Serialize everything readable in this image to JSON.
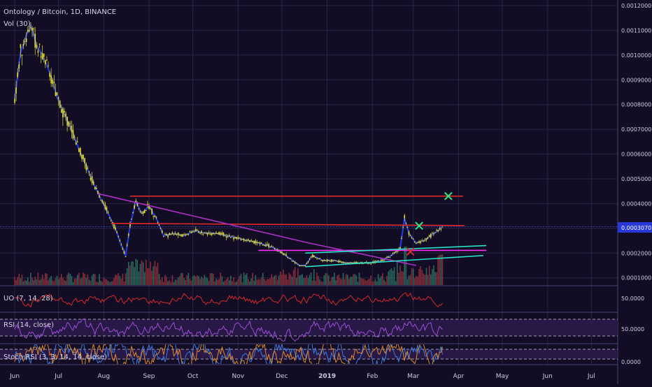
{
  "chart_data": {
    "type": "candlestick",
    "title": "Ontology / Bitcoin, 1D, BINANCE",
    "volume_label": "Vol (30)",
    "x_ticks": [
      "Jun",
      "Jul",
      "Aug",
      "Sep",
      "Oct",
      "Nov",
      "Dec",
      "2019",
      "Feb",
      "Mar",
      "Apr",
      "May",
      "Jun",
      "Jul"
    ],
    "price_axis": {
      "ticks": [
        "0.0001000",
        "0.0002000",
        "0.0003000",
        "0.0004000",
        "0.0005000",
        "0.0006000",
        "0.0007000",
        "0.0008000",
        "0.0009000",
        "0.0010000",
        "0.0011000",
        "0.0012000"
      ],
      "current_price_label": "0.0003070",
      "current_price": 0.000307,
      "ylim": [
        9.35e-05,
        0.0012
      ]
    },
    "price_series": [
      {
        "date": "2018-06-01",
        "price": 0.00082
      },
      {
        "date": "2018-06-05",
        "price": 0.00101
      },
      {
        "date": "2018-06-09",
        "price": 0.00108
      },
      {
        "date": "2018-06-12",
        "price": 0.00112
      },
      {
        "date": "2018-06-16",
        "price": 0.00104
      },
      {
        "date": "2018-06-20",
        "price": 0.001
      },
      {
        "date": "2018-06-25",
        "price": 0.00093
      },
      {
        "date": "2018-06-30",
        "price": 0.00083
      },
      {
        "date": "2018-07-05",
        "price": 0.00076
      },
      {
        "date": "2018-07-10",
        "price": 0.0007
      },
      {
        "date": "2018-07-15",
        "price": 0.00062
      },
      {
        "date": "2018-07-20",
        "price": 0.00055
      },
      {
        "date": "2018-07-25",
        "price": 0.00048
      },
      {
        "date": "2018-07-30",
        "price": 0.00042
      },
      {
        "date": "2018-08-04",
        "price": 0.00036
      },
      {
        "date": "2018-08-09",
        "price": 0.0003
      },
      {
        "date": "2018-08-13",
        "price": 0.00023
      },
      {
        "date": "2018-08-16",
        "price": 0.00019
      },
      {
        "date": "2018-08-19",
        "price": 0.00031
      },
      {
        "date": "2018-08-23",
        "price": 0.00041
      },
      {
        "date": "2018-08-27",
        "price": 0.00036
      },
      {
        "date": "2018-09-01",
        "price": 0.00039
      },
      {
        "date": "2018-09-06",
        "price": 0.00034
      },
      {
        "date": "2018-09-11",
        "price": 0.00027
      },
      {
        "date": "2018-09-18",
        "price": 0.00028
      },
      {
        "date": "2018-09-25",
        "price": 0.00027
      },
      {
        "date": "2018-10-02",
        "price": 0.00029
      },
      {
        "date": "2018-10-10",
        "price": 0.00028
      },
      {
        "date": "2018-10-17",
        "price": 0.00028
      },
      {
        "date": "2018-10-24",
        "price": 0.00027
      },
      {
        "date": "2018-11-01",
        "price": 0.00026
      },
      {
        "date": "2018-11-08",
        "price": 0.00025
      },
      {
        "date": "2018-11-15",
        "price": 0.00024
      },
      {
        "date": "2018-11-22",
        "price": 0.00023
      },
      {
        "date": "2018-11-29",
        "price": 0.00021
      },
      {
        "date": "2018-12-06",
        "price": 0.00018
      },
      {
        "date": "2018-12-13",
        "price": 0.00015
      },
      {
        "date": "2018-12-17",
        "price": 0.00015
      },
      {
        "date": "2018-12-22",
        "price": 0.00019
      },
      {
        "date": "2018-12-29",
        "price": 0.00017
      },
      {
        "date": "2019-01-06",
        "price": 0.00017
      },
      {
        "date": "2019-01-14",
        "price": 0.00016
      },
      {
        "date": "2019-01-22",
        "price": 0.00016
      },
      {
        "date": "2019-01-30",
        "price": 0.00016
      },
      {
        "date": "2019-02-07",
        "price": 0.00017
      },
      {
        "date": "2019-02-14",
        "price": 0.00019
      },
      {
        "date": "2019-02-20",
        "price": 0.00022
      },
      {
        "date": "2019-02-23",
        "price": 0.00034
      },
      {
        "date": "2019-02-26",
        "price": 0.00028
      },
      {
        "date": "2019-03-03",
        "price": 0.00024
      },
      {
        "date": "2019-03-08",
        "price": 0.00025
      },
      {
        "date": "2019-03-13",
        "price": 0.00027
      },
      {
        "date": "2019-03-18",
        "price": 0.00029
      },
      {
        "date": "2019-03-21",
        "price": 0.00031
      }
    ],
    "lines": [
      {
        "color": "#e0292c",
        "points": [
          {
            "date": "2018-08-19",
            "price": 0.00043
          },
          {
            "date": "2019-04-04",
            "price": 0.00043
          }
        ]
      },
      {
        "color": "#e0292c",
        "points": [
          {
            "date": "2018-08-06",
            "price": 0.00032
          },
          {
            "date": "2019-04-05",
            "price": 0.000311
          }
        ]
      },
      {
        "color": "#ff2fff",
        "points": [
          {
            "date": "2018-11-15",
            "price": 0.000211
          },
          {
            "date": "2019-04-20",
            "price": 0.000211
          }
        ]
      },
      {
        "color": "#b02fc8",
        "points": [
          {
            "date": "2018-07-28",
            "price": 0.00044
          },
          {
            "date": "2018-12-20",
            "price": 0.00024
          },
          {
            "date": "2019-03-03",
            "price": 0.00015
          }
        ]
      },
      {
        "color": "#29e0c8",
        "points": [
          {
            "date": "2018-12-17",
            "price": 0.000145
          },
          {
            "date": "2019-04-18",
            "price": 0.00019
          }
        ]
      },
      {
        "color": "#29e0c8",
        "points": [
          {
            "date": "2018-12-17",
            "price": 0.0002
          },
          {
            "date": "2019-04-20",
            "price": 0.00023
          }
        ]
      }
    ],
    "markers": [
      {
        "symbol": "✕",
        "color": "#2fe88a",
        "date": "2019-03-25",
        "price": 0.00043
      },
      {
        "symbol": "✕",
        "color": "#2fe88a",
        "date": "2019-03-05",
        "price": 0.00031
      },
      {
        "symbol": "✕",
        "color": "#e0292c",
        "date": "2019-02-27",
        "price": 0.000205
      }
    ],
    "indicators": [
      {
        "label": "UO (7, 14, 28)",
        "value_label": "50.0000",
        "color": "#d42a2a"
      },
      {
        "label": "RSI (14, close)",
        "value_label": "50.0000",
        "color": "#9b4fd6"
      },
      {
        "label": "Stoch RSI (3, 3, 14, 14, close)",
        "value_label": "0.0000",
        "color": "#3b7de0"
      }
    ],
    "colors": {
      "background": "#120d24",
      "grid": "#2a2447",
      "price_line": "#1f3bd8",
      "candles": "#e8e02a",
      "volume_up": "#2a6b5f",
      "volume_down": "#8a2f3a",
      "current_price_box": "#2838d9"
    }
  }
}
